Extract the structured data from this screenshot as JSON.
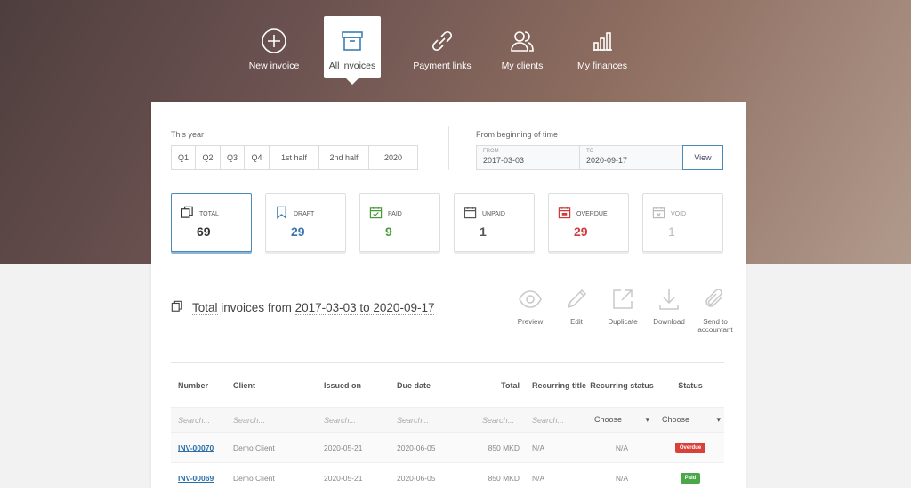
{
  "nav": [
    {
      "label": "New invoice",
      "icon": "plus-circle-icon",
      "active": false
    },
    {
      "label": "All invoices",
      "icon": "archive-box-icon",
      "active": true
    },
    {
      "label": "Payment links",
      "icon": "link-icon",
      "active": false
    },
    {
      "label": "My clients",
      "icon": "users-icon",
      "active": false
    },
    {
      "label": "My finances",
      "icon": "bar-chart-icon",
      "active": false
    }
  ],
  "filters": {
    "this_year_label": "This year",
    "periods": [
      "Q1",
      "Q2",
      "Q3",
      "Q4",
      "1st half",
      "2nd half",
      "2020"
    ],
    "range_label": "From beginning of time",
    "from_label": "FROM",
    "from_value": "2017-03-03",
    "to_label": "TO",
    "to_value": "2020-09-17",
    "view_label": "View"
  },
  "cards": [
    {
      "label": "TOTAL",
      "value": "69",
      "color": "#333333",
      "icon": "copy-icon"
    },
    {
      "label": "DRAFT",
      "value": "29",
      "color": "#3a76b0",
      "icon": "bookmark-icon"
    },
    {
      "label": "PAID",
      "value": "9",
      "color": "#4a9a3a",
      "icon": "calendar-check-icon"
    },
    {
      "label": "UNPAID",
      "value": "1",
      "color": "#555555",
      "icon": "calendar-icon"
    },
    {
      "label": "OVERDUE",
      "value": "29",
      "color": "#d03b3b",
      "icon": "calendar-alert-icon"
    },
    {
      "label": "VOID",
      "value": "1",
      "color": "#bbbbbb",
      "icon": "calendar-void-icon"
    }
  ],
  "list": {
    "title_prefix": "Total",
    "title_mid": "invoices from",
    "title_range": "2017-03-03 to 2020-09-17"
  },
  "actions": [
    {
      "label": "Preview",
      "icon": "eye-icon"
    },
    {
      "label": "Edit",
      "icon": "pencil-icon"
    },
    {
      "label": "Duplicate",
      "icon": "external-icon"
    },
    {
      "label": "Download",
      "icon": "download-icon"
    },
    {
      "label": "Send to accountant",
      "icon": "paperclip-icon"
    }
  ],
  "table": {
    "headers": [
      "Number",
      "Client",
      "Issued on",
      "Due date",
      "Total",
      "Recurring title",
      "Recurring status",
      "Status"
    ],
    "search_placeholder": "Search...",
    "choose_label": "Choose",
    "rows": [
      {
        "number": "INV-00070",
        "client": "Demo Client",
        "issued": "2020-05-21",
        "due": "2020-06-05",
        "total": "850 MKD",
        "rtitle": "N/A",
        "rstatus": "N/A",
        "status": "Overdue",
        "status_color": "#d9403a"
      },
      {
        "number": "INV-00069",
        "client": "Demo Client",
        "issued": "2020-05-21",
        "due": "2020-06-05",
        "total": "850 MKD",
        "rtitle": "N/A",
        "rstatus": "N/A",
        "status": "Paid",
        "status_color": "#4aa84a"
      }
    ]
  }
}
